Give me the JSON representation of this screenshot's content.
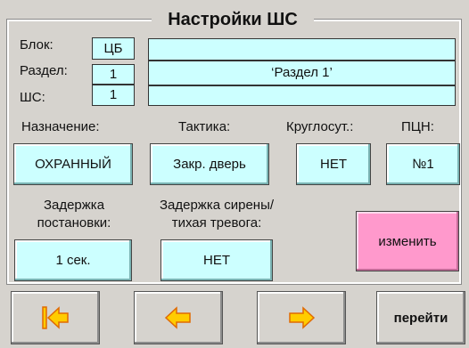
{
  "screen": {
    "title": "Настройки ШС"
  },
  "addr": {
    "block_label": "Блок:",
    "block_value": "ЦБ",
    "section_label": "Раздел:",
    "section_value": "1",
    "zone_label": "ШС:",
    "zone_value": "1",
    "name_row1": "",
    "name_row2": "‘Раздел 1’",
    "name_row3": ""
  },
  "settings": {
    "purpose_label": "Назначение:",
    "purpose_value": "ОХРАННЫЙ",
    "tactic_label": "Тактика:",
    "tactic_value": "Закр. дверь",
    "round_label": "Круглосут.:",
    "round_value": "НЕТ",
    "pcn_label": "ПЦН:",
    "pcn_value": "№1",
    "arm_delay_label_1": "Задержка",
    "arm_delay_label_2": "постановки:",
    "arm_delay_value": "1 сек.",
    "siren_label_1": "Задержка сирены/",
    "siren_label_2": "тихая тревога:",
    "siren_value": "НЕТ",
    "change_label": "изменить"
  },
  "nav": {
    "first_icon": "arrow-to-start-icon",
    "prev_icon": "arrow-left-icon",
    "next_icon": "arrow-right-icon",
    "goto_label": "перейти"
  },
  "colors": {
    "field": "#ccffff",
    "accent_pink": "#ff99cc",
    "arrow_fill": "#ffcc00",
    "arrow_stroke": "#e06a00",
    "panel": "#d6d3ce"
  }
}
